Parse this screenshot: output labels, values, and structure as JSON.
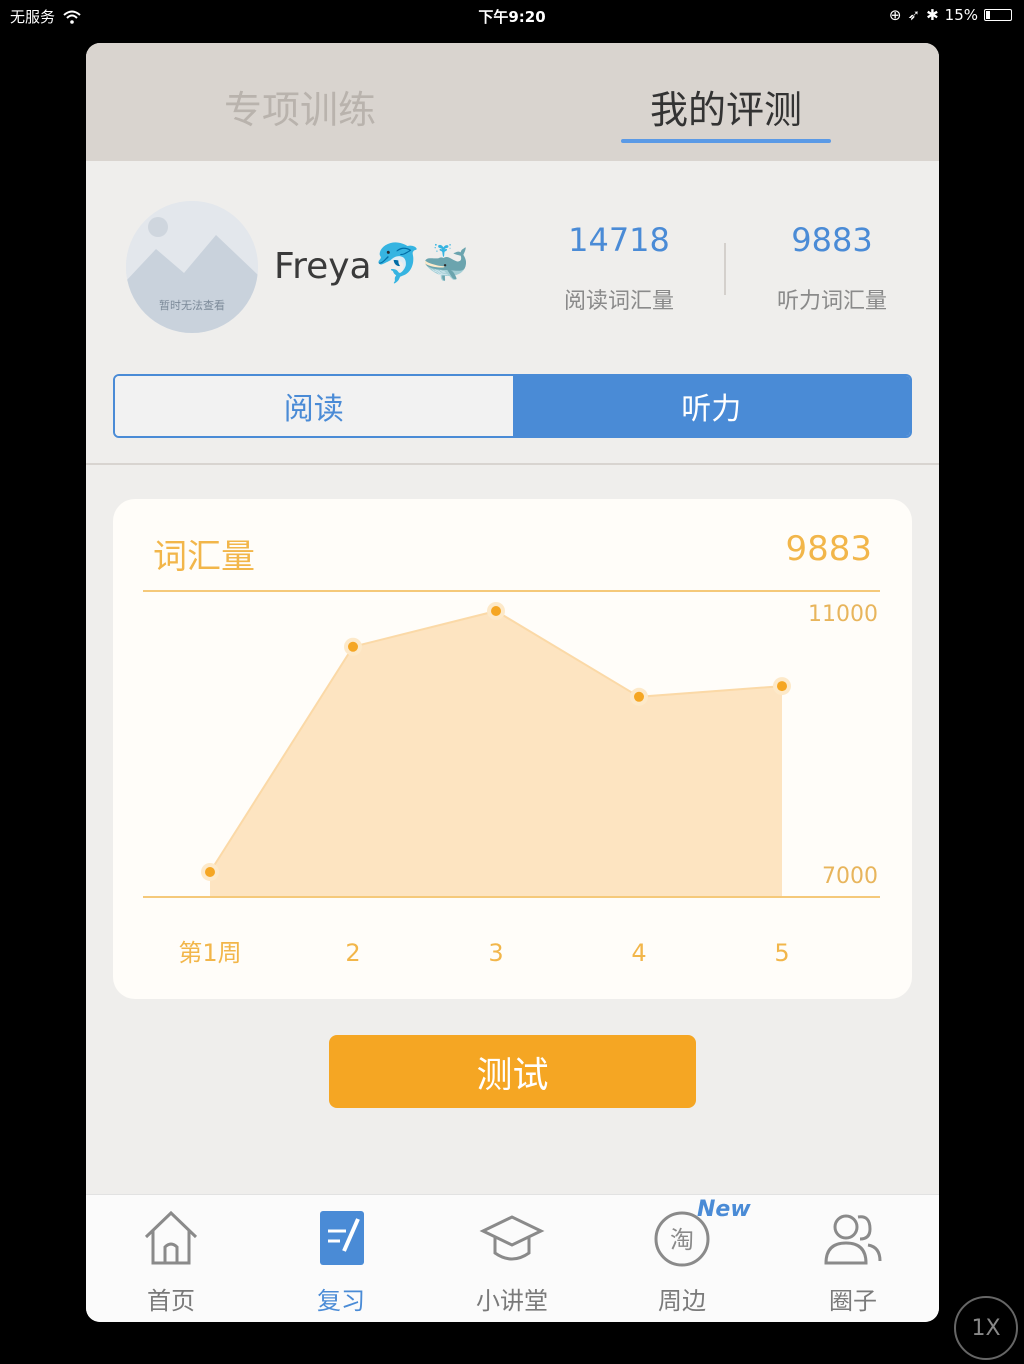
{
  "status_bar": {
    "carrier": "无服务",
    "time": "下午9:20",
    "battery": "15%",
    "battery_level": 0.15
  },
  "top_tabs": [
    {
      "label": "专项训练",
      "active": false
    },
    {
      "label": "我的评测",
      "active": true
    }
  ],
  "profile": {
    "name": "Freya",
    "emojis": [
      "🐬",
      "🐳"
    ],
    "avatar_caption": "暂时无法查看",
    "stats": [
      {
        "value": "14718",
        "label": "阅读词汇量"
      },
      {
        "value": "9883",
        "label": "听力词汇量"
      }
    ]
  },
  "segment": {
    "options": [
      "阅读",
      "听力"
    ],
    "selected": "听力"
  },
  "chart_card": {
    "title": "词汇量",
    "value": "9883"
  },
  "chart_data": {
    "type": "area",
    "categories": [
      "第1周",
      "2",
      "3",
      "4",
      "5"
    ],
    "values": [
      7350,
      10500,
      11000,
      9800,
      9950
    ],
    "ylim": [
      7000,
      11000
    ],
    "y_ticks": [
      "11000",
      "7000"
    ],
    "color": "#f5a623",
    "fill": "#fde4c1"
  },
  "test_button": {
    "label": "测试"
  },
  "bottom_nav": [
    {
      "label": "首页",
      "icon": "home-icon",
      "active": false
    },
    {
      "label": "复习",
      "icon": "review-icon",
      "active": true
    },
    {
      "label": "小讲堂",
      "icon": "graduation-cap-icon",
      "active": false
    },
    {
      "label": "周边",
      "icon": "taobao-icon",
      "active": false,
      "badge": "New"
    },
    {
      "label": "圈子",
      "icon": "people-icon",
      "active": false
    }
  ],
  "speed_badge": "1X",
  "colors": {
    "accent_blue": "#4a8bd6",
    "accent_orange": "#f5a623"
  }
}
